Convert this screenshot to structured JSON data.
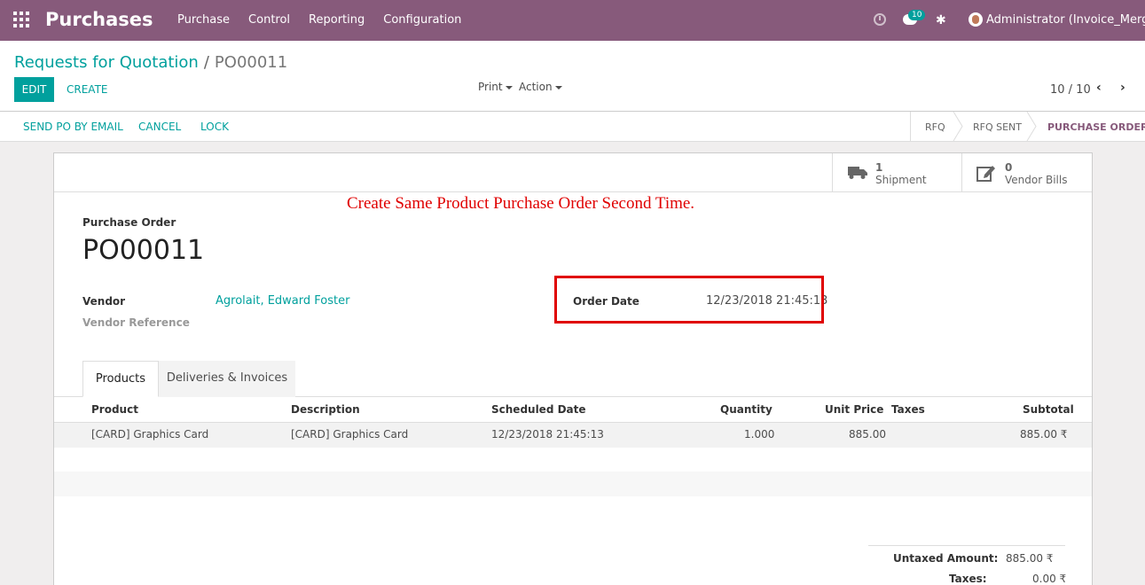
{
  "navbar": {
    "brand": "Purchases",
    "menu": [
      "Purchase",
      "Control",
      "Reporting",
      "Configuration"
    ],
    "chat_badge": "10",
    "user": "Administrator (Invoice_Merge)"
  },
  "breadcrumb": {
    "parent": "Requests for Quotation",
    "separator": "/",
    "current": "PO00011"
  },
  "buttons": {
    "edit": "EDIT",
    "create": "CREATE",
    "print": "Print",
    "action": "Action"
  },
  "pager": {
    "value": "10 / 10"
  },
  "statusbar": {
    "actions": [
      "SEND PO BY EMAIL",
      "CANCEL",
      "LOCK"
    ],
    "stages": [
      "RFQ",
      "RFQ SENT",
      "PURCHASE ORDER"
    ],
    "active_stage": "PURCHASE ORDER"
  },
  "smart_buttons": [
    {
      "count": "1",
      "label": "Shipment",
      "icon": "truck-icon"
    },
    {
      "count": "0",
      "label": "Vendor Bills",
      "icon": "edit-bill-icon"
    }
  ],
  "annotation": "Create Same Product Purchase Order Second Time.",
  "form": {
    "title_label": "Purchase Order",
    "name": "PO00011",
    "vendor_label": "Vendor",
    "vendor_value": "Agrolait, Edward Foster",
    "vendor_ref_label": "Vendor Reference",
    "order_date_label": "Order Date",
    "order_date_value": "12/23/2018 21:45:13"
  },
  "tabs": [
    "Products",
    "Deliveries & Invoices"
  ],
  "table": {
    "headers": [
      "Product",
      "Description",
      "Scheduled Date",
      "Quantity",
      "Unit Price",
      "Taxes",
      "Subtotal"
    ],
    "rows": [
      [
        "[CARD] Graphics Card",
        "[CARD] Graphics Card",
        "12/23/2018 21:45:13",
        "1.000",
        "885.00",
        "",
        "885.00 ₹"
      ]
    ]
  },
  "totals": {
    "untaxed_label": "Untaxed Amount:",
    "untaxed_value": "885.00 ₹",
    "taxes_label": "Taxes:",
    "taxes_value": "0.00 ₹"
  },
  "colors": {
    "brand": "#875a7b",
    "accent": "#00a09d",
    "annotation": "#e00000"
  }
}
